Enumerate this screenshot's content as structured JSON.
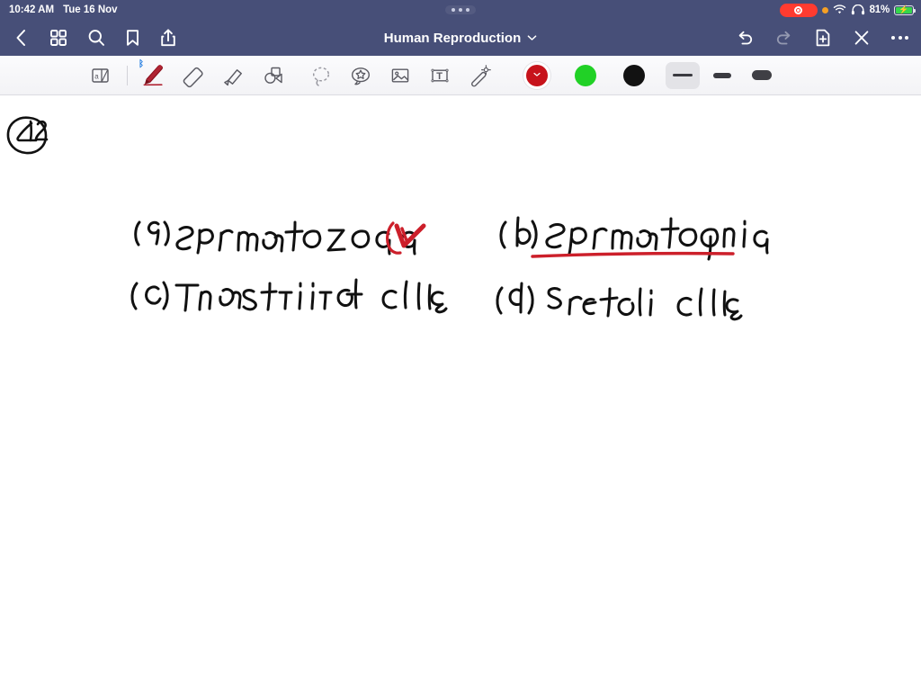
{
  "status_bar": {
    "time": "10:42 AM",
    "date": "Tue 16 Nov",
    "battery_percent": "81%",
    "icons": [
      "screen-recording-indicator",
      "orange-privacy-dot",
      "wifi-icon",
      "headphones-icon",
      "battery-charging-icon"
    ],
    "drag_handle": "multitasking-handle"
  },
  "nav_bar": {
    "title": "Human Reproduction",
    "title_chevron": "chevron-down-icon",
    "left_icons": [
      "back-icon",
      "grid-icon",
      "search-icon",
      "bookmark-icon",
      "share-icon"
    ],
    "right_icons": [
      "undo-icon",
      "redo-icon",
      "add-page-icon",
      "close-icon",
      "more-icon"
    ],
    "background_color": "#474f78"
  },
  "toolbar": {
    "tools": [
      {
        "name": "page-flip-tool",
        "label": "Page",
        "selected": false
      },
      {
        "name": "pen-tool",
        "label": "Pen",
        "selected": true,
        "bluetooth": true
      },
      {
        "name": "eraser-tool",
        "label": "Eraser",
        "selected": false
      },
      {
        "name": "highlighter-tool",
        "label": "Highlighter",
        "selected": false
      },
      {
        "name": "shapes-tool",
        "label": "Shapes",
        "selected": false
      },
      {
        "name": "lasso-tool",
        "label": "Lasso",
        "selected": false
      },
      {
        "name": "sticker-tool",
        "label": "Sticker",
        "selected": false
      },
      {
        "name": "image-tool",
        "label": "Image",
        "selected": false
      },
      {
        "name": "text-tool",
        "label": "Text",
        "selected": false
      },
      {
        "name": "magic-wand-tool",
        "label": "Magic",
        "selected": false
      }
    ],
    "colors": [
      {
        "name": "color-red",
        "hex": "#c7131b",
        "selected": true
      },
      {
        "name": "color-green",
        "hex": "#21d126",
        "selected": false
      },
      {
        "name": "color-black",
        "hex": "#121212",
        "selected": false
      }
    ],
    "stroke_widths": [
      {
        "name": "stroke-thin",
        "selected": true
      },
      {
        "name": "stroke-medium",
        "selected": false
      },
      {
        "name": "stroke-thick",
        "selected": false
      }
    ]
  },
  "canvas": {
    "page_number": "42",
    "ink_black": "#111111",
    "ink_red": "#cc1f2a",
    "notes": [
      {
        "id": "option-a",
        "text": "(a) Spermatozoa",
        "annotation": "red-check-mark"
      },
      {
        "id": "option-b",
        "text": "(b) Spermatogonia",
        "annotation": "red-underline"
      },
      {
        "id": "option-c",
        "text": "(c) Interstitial cells",
        "annotation": ""
      },
      {
        "id": "option-d",
        "text": "(d) Sertoli cells",
        "annotation": ""
      }
    ]
  }
}
